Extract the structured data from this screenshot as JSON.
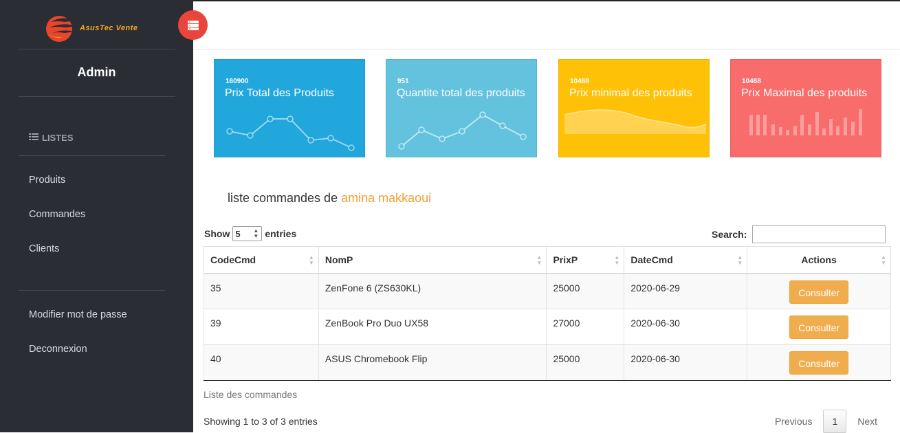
{
  "app": {
    "brand": "AsusTec Vente",
    "user": "Admin"
  },
  "colors": {
    "sidebar": "#2a2d33",
    "accent": "#f0a032",
    "toggle": "#e8453c",
    "button": "#f0ad4e"
  },
  "sidebar": {
    "section_title": "LISTES",
    "section_icon": "list-icon",
    "items": [
      {
        "label": "Produits"
      },
      {
        "label": "Commandes"
      },
      {
        "label": "Clients"
      }
    ],
    "bottom_items": [
      {
        "label": "Modifier mot de passe"
      },
      {
        "label": "Deconnexion"
      }
    ]
  },
  "stats": [
    {
      "value": "160900",
      "label": "Prix Total des Produits",
      "color": "#21a7dc",
      "spark": "line"
    },
    {
      "value": "951",
      "label": "Quantite total des produits",
      "color": "#63c2de",
      "spark": "line"
    },
    {
      "value": "10468",
      "label": "Prix minimal des produits",
      "color": "#ffc107",
      "spark": "area"
    },
    {
      "value": "10468",
      "label": "Prix Maximal des produits",
      "color": "#f86c6b",
      "spark": "bars"
    }
  ],
  "orders": {
    "title_prefix": "liste commandes de",
    "client_name": "amina makkaoui",
    "show_label": "Show",
    "entries_label": "entries",
    "page_length": "5",
    "search_label": "Search:",
    "search_value": "",
    "columns": [
      "CodeCmd",
      "NomP",
      "PrixP",
      "DateCmd",
      "Actions"
    ],
    "rows": [
      {
        "code": "35",
        "name": "ZenFone 6 (ZS630KL)",
        "price": "25000",
        "date": "2020-06-29",
        "action": "Consulter"
      },
      {
        "code": "39",
        "name": "ZenBook Pro Duo UX58",
        "price": "27000",
        "date": "2020-06-30",
        "action": "Consulter"
      },
      {
        "code": "40",
        "name": "ASUS Chromebook Flip",
        "price": "25000",
        "date": "2020-06-30",
        "action": "Consulter"
      }
    ],
    "caption": "Liste des commandes",
    "info": "Showing 1 to 3 of 3 entries",
    "pagination": {
      "previous": "Previous",
      "current": "1",
      "next": "Next"
    }
  }
}
